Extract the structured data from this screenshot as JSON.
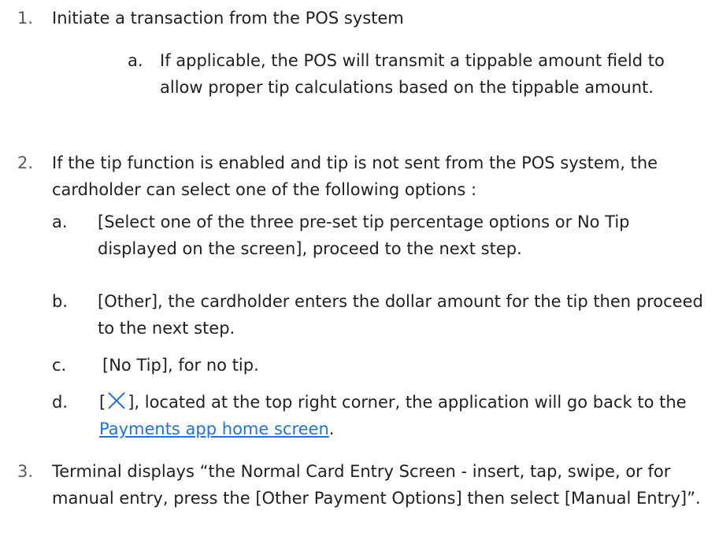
{
  "steps": [
    {
      "number": "1.",
      "text": "Initiate a transaction from the POS system",
      "subitems": [
        {
          "letter": "a.",
          "text": "If applicable, the POS will transmit a tippable amount field to allow proper tip calculations based on the tippable amount."
        }
      ]
    },
    {
      "number": "2.",
      "text": "If the tip function is enabled and tip is not sent from the POS system, the cardholder can select one of the following options :",
      "subitems": [
        {
          "letter": "a.",
          "text": "[Select one of the three pre-set tip percentage options or No Tip displayed on the screen], proceed to the next step."
        },
        {
          "letter": "b.",
          "text": "[Other], the cardholder enters the dollar amount for the tip then proceed to the next step."
        },
        {
          "letter": "c.",
          "text": "[No Tip], for no tip."
        },
        {
          "letter": "d.",
          "text_before_icon": "[",
          "icon": "close-icon",
          "text_after_icon": "], located at the top right corner, the application will go back to the",
          "link_text": "Payments app home screen",
          "text_end": ".",
          "icon_color": "#1a73e8"
        }
      ]
    },
    {
      "number": "3.",
      "text": "Terminal displays “the Normal Card Entry Screen - insert, tap, swipe, or for manual entry,  press the [Other Payment Options]  then select [Manual Entry]”."
    }
  ]
}
